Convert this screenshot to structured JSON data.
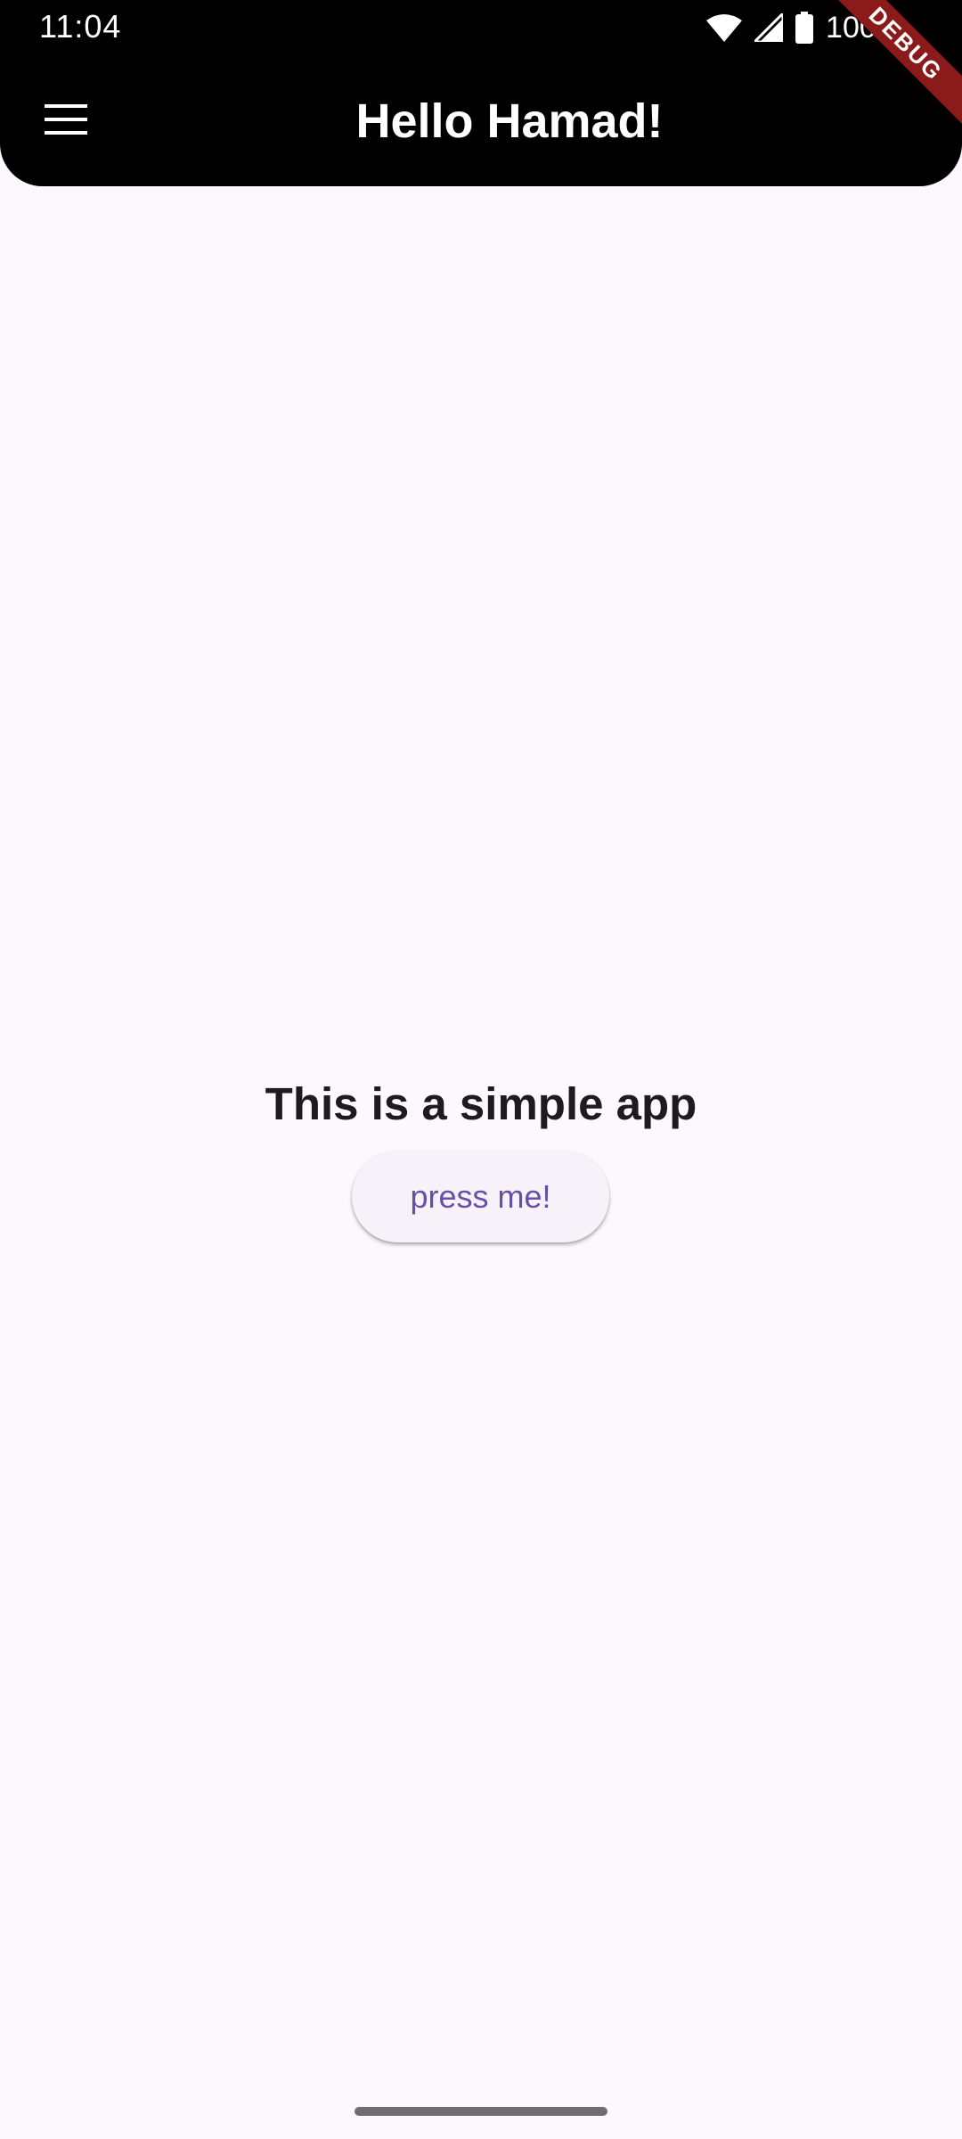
{
  "status_bar": {
    "time": "11:04",
    "battery_percent": "100%",
    "icons": [
      "wifi-icon",
      "cell-signal-icon",
      "battery-icon"
    ]
  },
  "app_bar": {
    "title": "Hello Hamad!",
    "menu_icon": "hamburger-menu-icon"
  },
  "debug_banner": {
    "label": "DEBUG"
  },
  "main": {
    "heading": "This is a simple app",
    "button_label": "press me!"
  },
  "colors": {
    "app_bar_background": "#000000",
    "page_background": "#FDF7FE",
    "button_background": "#F7F2FA",
    "button_text": "#6750A4",
    "heading_text": "#1D1B20",
    "debug_ribbon": "#8B1A1A"
  }
}
